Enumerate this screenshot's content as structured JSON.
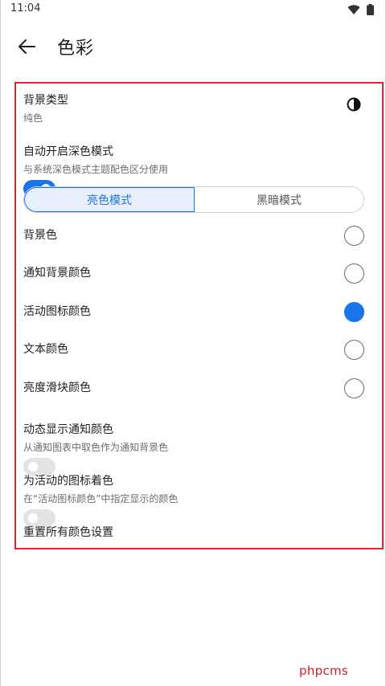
{
  "status_bar": {
    "time": "11:04",
    "icons": [
      "wifi-icon",
      "battery-icon"
    ]
  },
  "app_bar": {
    "title": "色彩",
    "back_icon": "arrow-left-icon"
  },
  "colors": {
    "accent": "#1a73e8",
    "highlight_border": "#e0242b",
    "watermark": "#d11f1f"
  },
  "settings": {
    "background_type": {
      "title": "背景类型",
      "subtitle": "纯色",
      "icon": "contrast-icon"
    },
    "auto_dark": {
      "title": "自动开启深色模式",
      "subtitle": "与系统深色模式主题配色区分使用",
      "enabled": true
    },
    "mode_tabs": {
      "light": "亮色模式",
      "dark": "黑暗模式",
      "selected": "light"
    },
    "color_options": [
      {
        "label": "背景色",
        "selected": false
      },
      {
        "label": "通知背景颜色",
        "selected": false
      },
      {
        "label": "活动图标颜色",
        "selected": true
      },
      {
        "label": "文本颜色",
        "selected": false
      },
      {
        "label": "亮度滑块颜色",
        "selected": false
      }
    ],
    "dynamic_notification": {
      "title": "动态显示通知颜色",
      "subtitle": "从通知图表中取色作为通知背景色",
      "enabled": false
    },
    "tint_active_icons": {
      "title": "为活动的图标着色",
      "subtitle": "在“活动图标颜色”中指定显示的颜色",
      "enabled": false
    },
    "reset": {
      "label": "重置所有颜色设置"
    }
  },
  "watermark": "phpcms"
}
